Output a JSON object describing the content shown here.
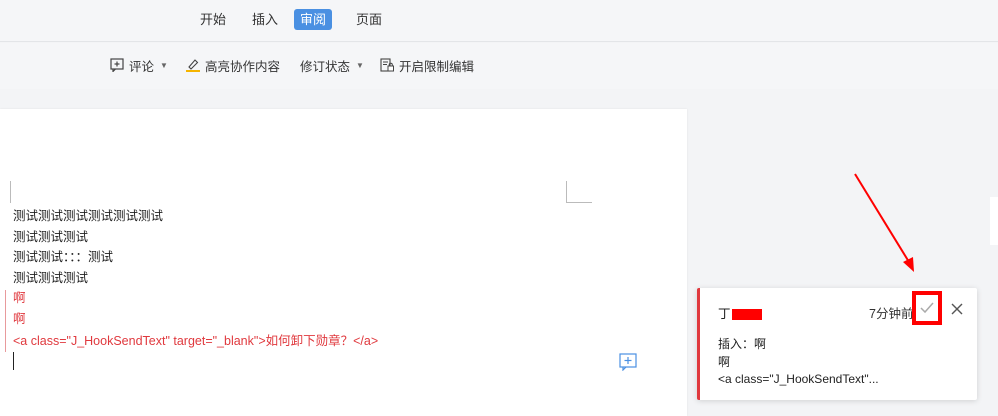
{
  "tabs": [
    "开始",
    "插入",
    "审阅",
    "页面"
  ],
  "toolbar": {
    "comment_label": "评论",
    "highlight_label": "高亮协作内容",
    "revision_label": "修订状态",
    "restrict_label": "开启限制编辑"
  },
  "document": {
    "lines": [
      "测试测试测试测试测试测试",
      "测试测试测试",
      "测试测试：：：测试",
      "测试测试测试",
      "啊",
      "啊",
      "<a class=\"J_HookSendText\" target=\"_blank\">如何卸下勋章？</a>"
    ]
  },
  "comment": {
    "author_prefix": "丁",
    "time": "7分钟前",
    "insert_line": "插入：啊",
    "line2": "啊",
    "line3": "<a class=\"J_HookSendText\"..."
  },
  "colors": {
    "accent": "#4a90e2",
    "revision_red": "#e0393e",
    "annotation_red": "#ff0000"
  }
}
